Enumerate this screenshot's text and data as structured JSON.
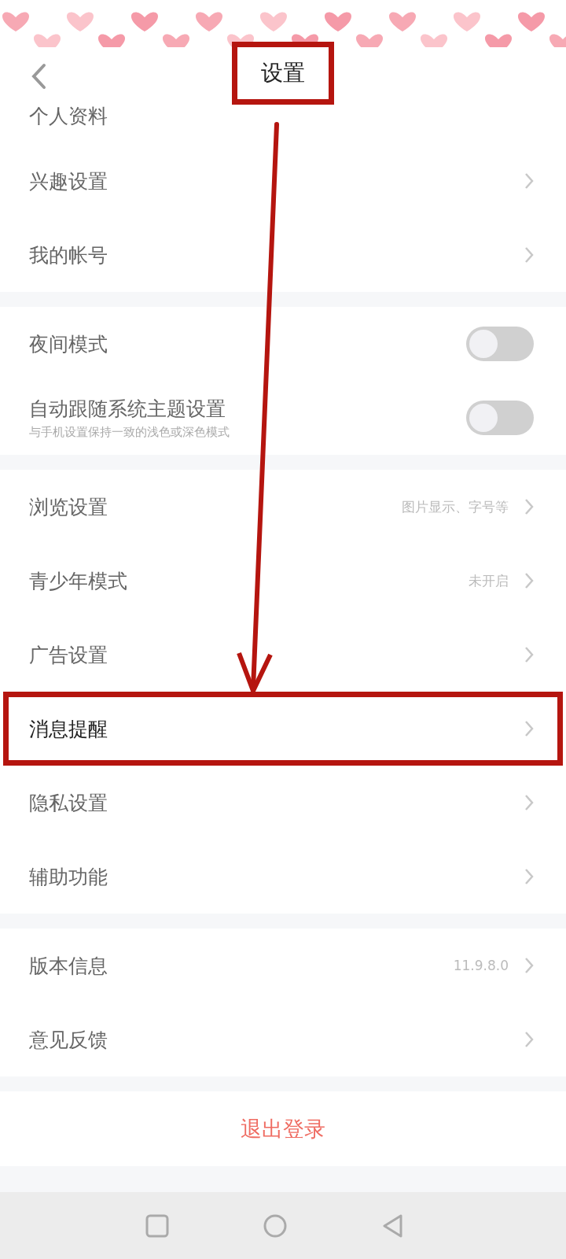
{
  "header": {
    "title": "设置",
    "title_highlighted": true
  },
  "sections": [
    {
      "items": [
        {
          "kind": "cut",
          "label": "个人资料",
          "highlighted": false
        },
        {
          "kind": "link",
          "label": "兴趣设置",
          "highlighted": false
        },
        {
          "kind": "link",
          "label": "我的帐号",
          "highlighted": false
        }
      ]
    },
    {
      "items": [
        {
          "kind": "toggle",
          "label": "夜间模式",
          "on": false,
          "highlighted": false
        },
        {
          "kind": "toggle",
          "label": "自动跟随系统主题设置",
          "subtitle": "与手机设置保持一致的浅色或深色模式",
          "on": false,
          "highlighted": false
        }
      ]
    },
    {
      "items": [
        {
          "kind": "link",
          "label": "浏览设置",
          "value": "图片显示、字号等",
          "highlighted": false
        },
        {
          "kind": "link",
          "label": "青少年模式",
          "value": "未开启",
          "highlighted": false
        },
        {
          "kind": "link",
          "label": "广告设置",
          "highlighted": false
        },
        {
          "kind": "link",
          "label": "消息提醒",
          "highlighted": true
        },
        {
          "kind": "link",
          "label": "隐私设置",
          "highlighted": false
        },
        {
          "kind": "link",
          "label": "辅助功能",
          "highlighted": false
        }
      ]
    },
    {
      "items": [
        {
          "kind": "link",
          "label": "版本信息",
          "value": "11.9.8.0",
          "highlighted": false
        },
        {
          "kind": "link",
          "label": "意见反馈",
          "highlighted": false
        }
      ]
    }
  ],
  "logout": "退出登录"
}
